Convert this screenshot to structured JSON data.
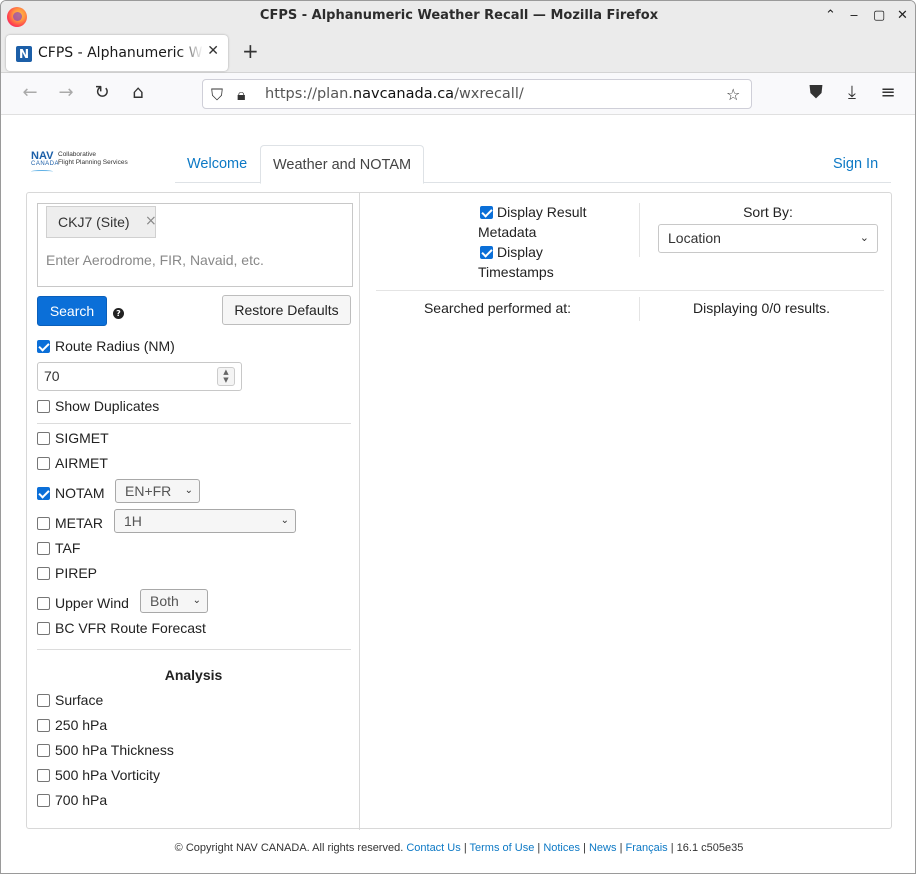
{
  "window": {
    "title": "CFPS - Alphanumeric Weather Recall — Mozilla Firefox"
  },
  "browser": {
    "tab_title": "CFPS - Alphanumeric Weather Recall",
    "tab_favicon": "N",
    "url_prefix": "https://plan.",
    "url_domain": "navcanada.ca",
    "url_path": "/wxrecall/"
  },
  "header": {
    "logo_nav": "NAV",
    "logo_canada": "CANADA",
    "logo_line1": "Collaborative",
    "logo_line2": "Flight Planning Services",
    "tabs": [
      {
        "label": "Welcome",
        "active": false
      },
      {
        "label": "Weather and NOTAM",
        "active": true
      }
    ],
    "sign_in": "Sign In"
  },
  "search": {
    "chip_label": "CKJ7 (Site)",
    "chip_close": "×",
    "placeholder": "Enter Aerodrome, FIR, Navaid, etc.",
    "search_button": "Search",
    "help": "?",
    "restore_button": "Restore Defaults"
  },
  "options": {
    "route_radius_label": "Route Radius (NM)",
    "route_radius_checked": true,
    "route_radius_value": "70",
    "show_duplicates_label": "Show Duplicates",
    "show_duplicates_checked": false
  },
  "products": {
    "sigmet": {
      "label": "SIGMET",
      "checked": false
    },
    "airmet": {
      "label": "AIRMET",
      "checked": false
    },
    "notam": {
      "label": "NOTAM",
      "checked": true,
      "select": "EN+FR"
    },
    "metar": {
      "label": "METAR",
      "checked": false,
      "select": "1H"
    },
    "taf": {
      "label": "TAF",
      "checked": false
    },
    "pirep": {
      "label": "PIREP",
      "checked": false
    },
    "upper_wind": {
      "label": "Upper Wind",
      "checked": false,
      "select": "Both"
    },
    "bc_vfr": {
      "label": "BC VFR Route Forecast",
      "checked": false
    }
  },
  "analysis": {
    "heading": "Analysis",
    "surface": "Surface",
    "hpa250": "250 hPa",
    "thickness500": "500 hPa Thickness",
    "vorticity500": "500 hPa Vorticity",
    "hpa700": "700 hPa"
  },
  "results": {
    "display_metadata_l1": "Display Result",
    "display_metadata_l2": "Metadata",
    "display_metadata_checked": true,
    "display_timestamps_l1": "Display",
    "display_timestamps_l2": "Timestamps",
    "display_timestamps_checked": true,
    "sort_by_label": "Sort By:",
    "sort_by_value": "Location",
    "searched_text": "Searched performed at:",
    "displaying_text": "Displaying 0/0 results."
  },
  "footer": {
    "copyright": "© Copyright NAV CANADA. All rights reserved.",
    "contact": "Contact Us",
    "terms": "Terms of Use",
    "notices": "Notices",
    "news": "News",
    "francais": "Français",
    "version": "16.1 c505e35",
    "sep": "|"
  },
  "colors": {
    "accent": "#0b6fd8",
    "link": "#0d79c5",
    "brand": "#1c5fa8"
  }
}
